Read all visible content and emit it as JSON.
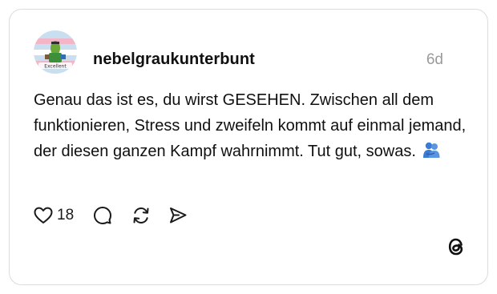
{
  "post": {
    "username": "nebelgraukunterbunt",
    "timestamp": "6d",
    "text": "Genau das ist es, du wirst GESEHEN. Zwischen all dem funktionieren, Stress und zweifeln kommt auf einmal jemand, der diesen ganzen Kampf wahrnimmt. Tut gut, sowas.",
    "emoji_icon": "people-hugging-icon",
    "avatar_caption": "Excellent",
    "likes_count": "18"
  },
  "icons": {
    "like": "heart-icon",
    "reply": "comment-bubble-icon",
    "repost": "repost-arrows-icon",
    "share": "send-icon",
    "brand": "threads-logo-icon"
  },
  "colors": {
    "text": "#101010",
    "muted": "#9a9a9a",
    "border": "#dcdcdc",
    "avatar_bg": "#c9dff0",
    "emoji_blue": "#3a7bd5"
  }
}
